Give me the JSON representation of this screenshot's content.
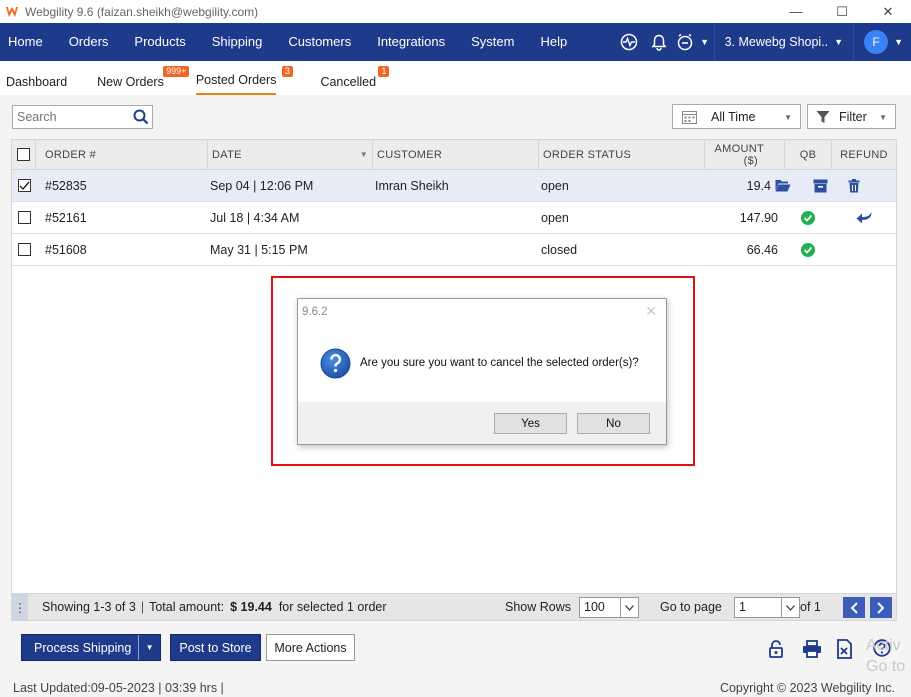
{
  "window": {
    "title": "Webgility 9.6 (faizan.sheikh@webgility.com)",
    "minimize": "—",
    "maximize": "☐",
    "close": "✕"
  },
  "nav": {
    "items": [
      "Home",
      "Orders",
      "Products",
      "Shipping",
      "Customers",
      "Integrations",
      "System",
      "Help"
    ],
    "store": "3. Mewebg Shopi..",
    "avatar_letter": "F"
  },
  "subtabs": [
    {
      "label": "Dashboard",
      "badge": ""
    },
    {
      "label": "New Orders",
      "badge": "999+"
    },
    {
      "label": "Posted Orders",
      "badge": "3"
    },
    {
      "label": "Cancelled",
      "badge": "1"
    }
  ],
  "toolbar": {
    "search_placeholder": "Search",
    "time_filter": "All Time",
    "filter_label": "Filter"
  },
  "table": {
    "headers": {
      "order": "ORDER #",
      "date": "DATE",
      "customer": "CUSTOMER",
      "status": "ORDER STATUS",
      "amount": "AMOUNT",
      "amount_unit": "($)",
      "qb": "QB",
      "refund": "REFUND"
    },
    "rows": [
      {
        "order": "#52835",
        "date": "Sep 04 | 12:06 PM",
        "customer": "Imran Sheikh",
        "status": "open",
        "amount": "19.4",
        "checked": true
      },
      {
        "order": "#52161",
        "date": "Jul 18 | 4:34 AM",
        "customer": "",
        "status": "open",
        "amount": "147.90",
        "checked": false
      },
      {
        "order": "#51608",
        "date": "May 31 | 5:15 PM",
        "customer": "",
        "status": "closed",
        "amount": "66.46",
        "checked": false
      }
    ]
  },
  "footer": {
    "showing": "Showing 1-3 of 3",
    "total_label": "Total amount:",
    "total_value": "$ 19.44",
    "selected_text": "for selected 1 order",
    "show_rows_label": "Show Rows",
    "show_rows_value": "100",
    "goto_label": "Go to page",
    "goto_value": "1",
    "of_label": "of 1"
  },
  "actions": {
    "process_shipping": "Process Shipping",
    "post_to_store": "Post to Store",
    "more_actions": "More Actions"
  },
  "status": {
    "last_updated": "Last Updated:09-05-2023 | 03:39 hrs |",
    "copyright": "Copyright © 2023 Webgility Inc."
  },
  "watermark": {
    "line1": "Activ",
    "line2": "Go to"
  },
  "dialog": {
    "title": "9.6.2",
    "message": "Are you sure you want to cancel the selected order(s)?",
    "yes": "Yes",
    "no": "No",
    "close": "✕"
  },
  "colors": {
    "nav_bg": "#1e3a8a",
    "badge": "#f26522",
    "highlight": "#dd1111",
    "success": "#22b14c"
  }
}
